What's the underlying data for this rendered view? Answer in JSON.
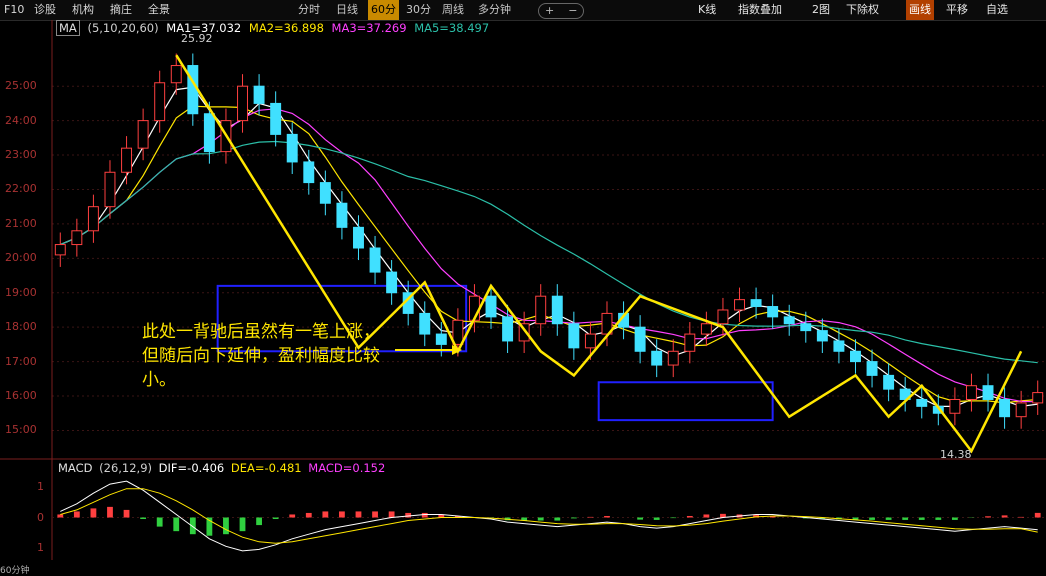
{
  "toolbar": {
    "left_items": [
      "F10",
      "诊股",
      "机构",
      "摘庄",
      "全景"
    ],
    "period_tabs": [
      "分时",
      "日线",
      "60分",
      "30分",
      "周线",
      "多分钟"
    ],
    "active_period": "60分",
    "zoom_in": "+",
    "zoom_out": "−",
    "right_items": [
      "K线",
      "指数叠加",
      "2图",
      "下除权",
      "画线",
      "平移",
      "自选"
    ],
    "active_right": "画线"
  },
  "ma_legend": {
    "name": "MA",
    "params": "(5,10,20,60)",
    "ma1": "MA1=37.032",
    "ma2": "MA2=36.898",
    "ma3": "MA3=37.269",
    "ma5": "MA5=38.497"
  },
  "macd_legend": {
    "name": "MACD",
    "params": "(26,12,9)",
    "dif": "DIF=-0.406",
    "dea": "DEA=-0.481",
    "macd": "MACD=0.152"
  },
  "annotation": "此处一背驰后虽然有一笔上涨，但随后向下延伸，盈利幅度比较小。",
  "labels": {
    "high": "25.92",
    "low": "14.38",
    "period": "60分钟"
  },
  "colors": {
    "up": "#ff4040",
    "down": "#40e0ff",
    "ma1": "#ffffff",
    "ma2": "#ffe600",
    "ma3": "#ff40ff",
    "ma4": "#2bbfa8",
    "zigzag": "#ffe600",
    "box": "#2020ff",
    "dif": "#ffffff",
    "dea": "#ffe600"
  },
  "chart_data": [
    {
      "type": "candlestick",
      "y_ticks": [
        "25:00",
        "24:00",
        "23:00",
        "22:00",
        "21:00",
        "20:00",
        "19:00",
        "18:00",
        "17:00",
        "16:00",
        "15:00"
      ],
      "ylim": [
        14.2,
        26.4
      ],
      "closes": [
        20.4,
        20.8,
        21.5,
        22.5,
        23.2,
        24.0,
        25.1,
        25.6,
        24.2,
        23.1,
        24.0,
        25.0,
        24.5,
        23.6,
        22.8,
        22.2,
        21.6,
        20.9,
        20.3,
        19.6,
        19.0,
        18.4,
        17.8,
        17.5,
        18.2,
        18.9,
        18.3,
        17.6,
        18.1,
        18.9,
        18.1,
        17.4,
        17.8,
        18.4,
        18.0,
        17.3,
        16.9,
        17.3,
        17.8,
        18.1,
        18.5,
        18.8,
        18.6,
        18.3,
        18.1,
        17.9,
        17.6,
        17.3,
        17.0,
        16.6,
        16.2,
        15.9,
        15.7,
        15.5,
        15.9,
        16.3,
        15.9,
        15.4,
        15.8,
        16.1
      ],
      "zigzag": [
        [
          0,
          25.9
        ],
        [
          10,
          17.4
        ],
        [
          13,
          19.3
        ],
        [
          15,
          17.3
        ],
        [
          17,
          19.2
        ],
        [
          19,
          17.3
        ],
        [
          21,
          16.6
        ],
        [
          25,
          18.9
        ],
        [
          29,
          18.0
        ],
        [
          33,
          15.4
        ],
        [
          36,
          16.6
        ],
        [
          38,
          15.4
        ],
        [
          40,
          16.3
        ],
        [
          42,
          14.4
        ],
        [
          45,
          17.3
        ]
      ],
      "boxes": [
        {
          "x0": 9.5,
          "x1": 24.5,
          "y0": 17.3,
          "y1": 19.2
        },
        {
          "x0": 32.5,
          "x1": 43.0,
          "y0": 15.3,
          "y1": 16.4
        }
      ],
      "labels": {
        "high": 25.92,
        "low": 14.38
      }
    },
    {
      "type": "bar",
      "series": [
        {
          "name": "DIF",
          "values": [
            0.2,
            0.45,
            0.8,
            1.1,
            1.2,
            0.9,
            0.5,
            0.1,
            -0.3,
            -0.7,
            -0.95,
            -1.1,
            -1.05,
            -0.9,
            -0.7,
            -0.55,
            -0.4,
            -0.3,
            -0.2,
            -0.1,
            0.0,
            0.05,
            0.1,
            0.1,
            0.05,
            0.0,
            -0.05,
            -0.15,
            -0.2,
            -0.25,
            -0.3,
            -0.25,
            -0.2,
            -0.15,
            -0.2,
            -0.3,
            -0.35,
            -0.3,
            -0.2,
            -0.1,
            0.0,
            0.05,
            0.1,
            0.1,
            0.05,
            0.0,
            -0.05,
            -0.1,
            -0.15,
            -0.2,
            -0.25,
            -0.3,
            -0.35,
            -0.4,
            -0.45,
            -0.4,
            -0.35,
            -0.3,
            -0.35,
            -0.406
          ]
        },
        {
          "name": "DEA",
          "values": [
            0.1,
            0.25,
            0.5,
            0.75,
            0.95,
            0.95,
            0.8,
            0.55,
            0.25,
            -0.1,
            -0.4,
            -0.65,
            -0.8,
            -0.85,
            -0.8,
            -0.7,
            -0.6,
            -0.5,
            -0.4,
            -0.3,
            -0.2,
            -0.1,
            -0.05,
            0.0,
            0.0,
            0.0,
            -0.02,
            -0.06,
            -0.1,
            -0.15,
            -0.2,
            -0.22,
            -0.22,
            -0.2,
            -0.2,
            -0.23,
            -0.27,
            -0.28,
            -0.25,
            -0.2,
            -0.12,
            -0.05,
            0.02,
            0.05,
            0.05,
            0.03,
            0.0,
            -0.04,
            -0.08,
            -0.12,
            -0.17,
            -0.22,
            -0.27,
            -0.32,
            -0.37,
            -0.39,
            -0.39,
            -0.37,
            -0.37,
            -0.481
          ]
        },
        {
          "name": "MACD",
          "values": [
            0.1,
            0.2,
            0.3,
            0.35,
            0.25,
            -0.05,
            -0.3,
            -0.45,
            -0.55,
            -0.6,
            -0.55,
            -0.45,
            -0.25,
            -0.05,
            0.1,
            0.15,
            0.2,
            0.2,
            0.2,
            0.2,
            0.2,
            0.15,
            0.15,
            0.1,
            0.05,
            0.0,
            -0.03,
            -0.09,
            -0.1,
            -0.1,
            -0.1,
            -0.03,
            0.02,
            0.05,
            0.0,
            -0.07,
            -0.08,
            -0.02,
            0.05,
            0.1,
            0.12,
            0.1,
            0.08,
            0.05,
            0.0,
            -0.03,
            -0.05,
            -0.06,
            -0.07,
            -0.08,
            -0.08,
            -0.08,
            -0.08,
            -0.08,
            -0.08,
            -0.01,
            0.04,
            0.07,
            0.02,
            0.152
          ]
        }
      ],
      "y_ticks": [
        "1",
        "0",
        "1"
      ],
      "ylim": [
        -1.4,
        1.4
      ]
    }
  ]
}
